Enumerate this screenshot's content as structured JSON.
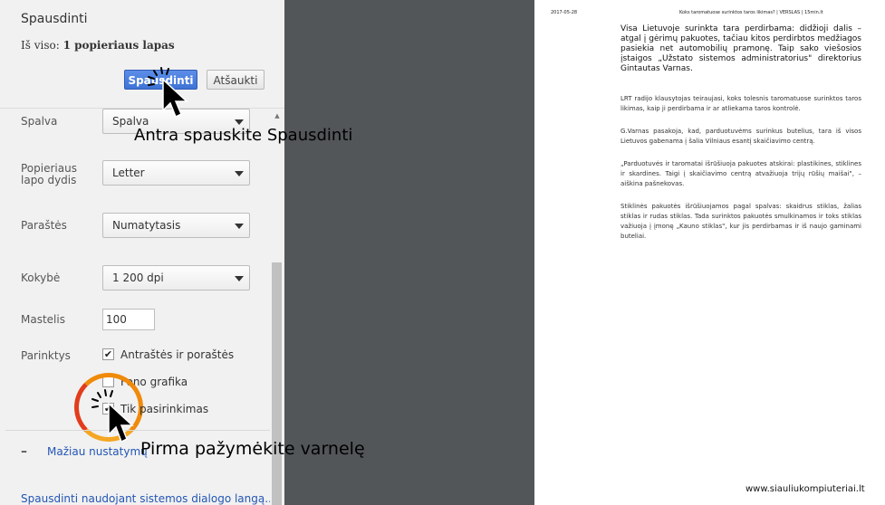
{
  "dialog": {
    "title": "Spausdinti",
    "total_label": "Iš viso:",
    "total_value": "1 popieriaus lapas",
    "print_button": "Spausdinti",
    "cancel_button": "Atšaukti"
  },
  "settings": {
    "color": {
      "label": "Spalva",
      "value": "Spalva"
    },
    "paper_size": {
      "label_line1": "Popieriaus",
      "label_line2": "lapo dydis",
      "value": "Letter"
    },
    "margins": {
      "label": "Paraštės",
      "value": "Numatytasis"
    },
    "quality": {
      "label": "Kokybė",
      "value": "1 200 dpi"
    },
    "scale": {
      "label": "Mastelis",
      "value": "100"
    },
    "options": {
      "label": "Parinktys",
      "items": [
        {
          "label": "Antraštės ir poraštės",
          "checked": true
        },
        {
          "label": "Fono grafika",
          "checked": false
        },
        {
          "label": "Tik pasirinkimas",
          "checked": true
        }
      ]
    },
    "fewer_settings": "Mažiau nustatymų",
    "system_dialog_link": "Spausdinti naudojant sistemos dialogo langą..."
  },
  "annotations": {
    "second_step": "Antra spauskite Spausdinti",
    "first_step": "Pirma pažymėkite varnelę"
  },
  "preview": {
    "header_date": "2017-05-28",
    "header_title": "Koks taromatuose surinktos taros likimas? | VERSLAS | 15min.lt",
    "lead": "Visa Lietuvoje surinkta tara perdirbama: didžioji dalis – atgal į gėrimų pakuotes, tačiau kitos perdirbtos medžiagos pasiekia net automobilių pramonę. Taip sako viešosios įstaigos „Užstato sistemos administratorius\" direktorius Gintautas Varnas.",
    "paragraphs": [
      "LRT radijo klausytojas teiraujasi, koks tolesnis taromatuose surinktos taros likimas, kaip ji perdirbama ir ar atliekama taros kontrolė.",
      "G.Varnas pasakoja, kad, parduotuvėms surinkus butelius, tara iš visos Lietuvos gabenama į šalia Vilniaus esantį skaičiavimo centrą.",
      "„Parduotuvės ir taromatai išrūšiuoja pakuotes atskirai: plastikines, stiklines ir skardines. Taigi į skaičiavimo centrą atvažiuoja trijų rūšių maišai\", – aiškina pašnekovas.",
      "Stiklinės pakuotės išrūšiuojamos pagal spalvas: skaidrus stiklas, žalias stiklas ir rudas stiklas. Tada surinktos pakuotės smulkinamos ir toks stiklas važiuoja į įmonę „Kauno stiklas\", kur jis perdirbamas ir iš naujo gaminami buteliai."
    ],
    "footer_url": "www.siauliukompiuteriai.lt"
  },
  "colors": {
    "panel_bg": "#f1f1f1",
    "preview_bg": "#525659",
    "primary_button": "#3e73d6",
    "link": "#2255b4",
    "highlight_ring": "#f08a0a"
  }
}
